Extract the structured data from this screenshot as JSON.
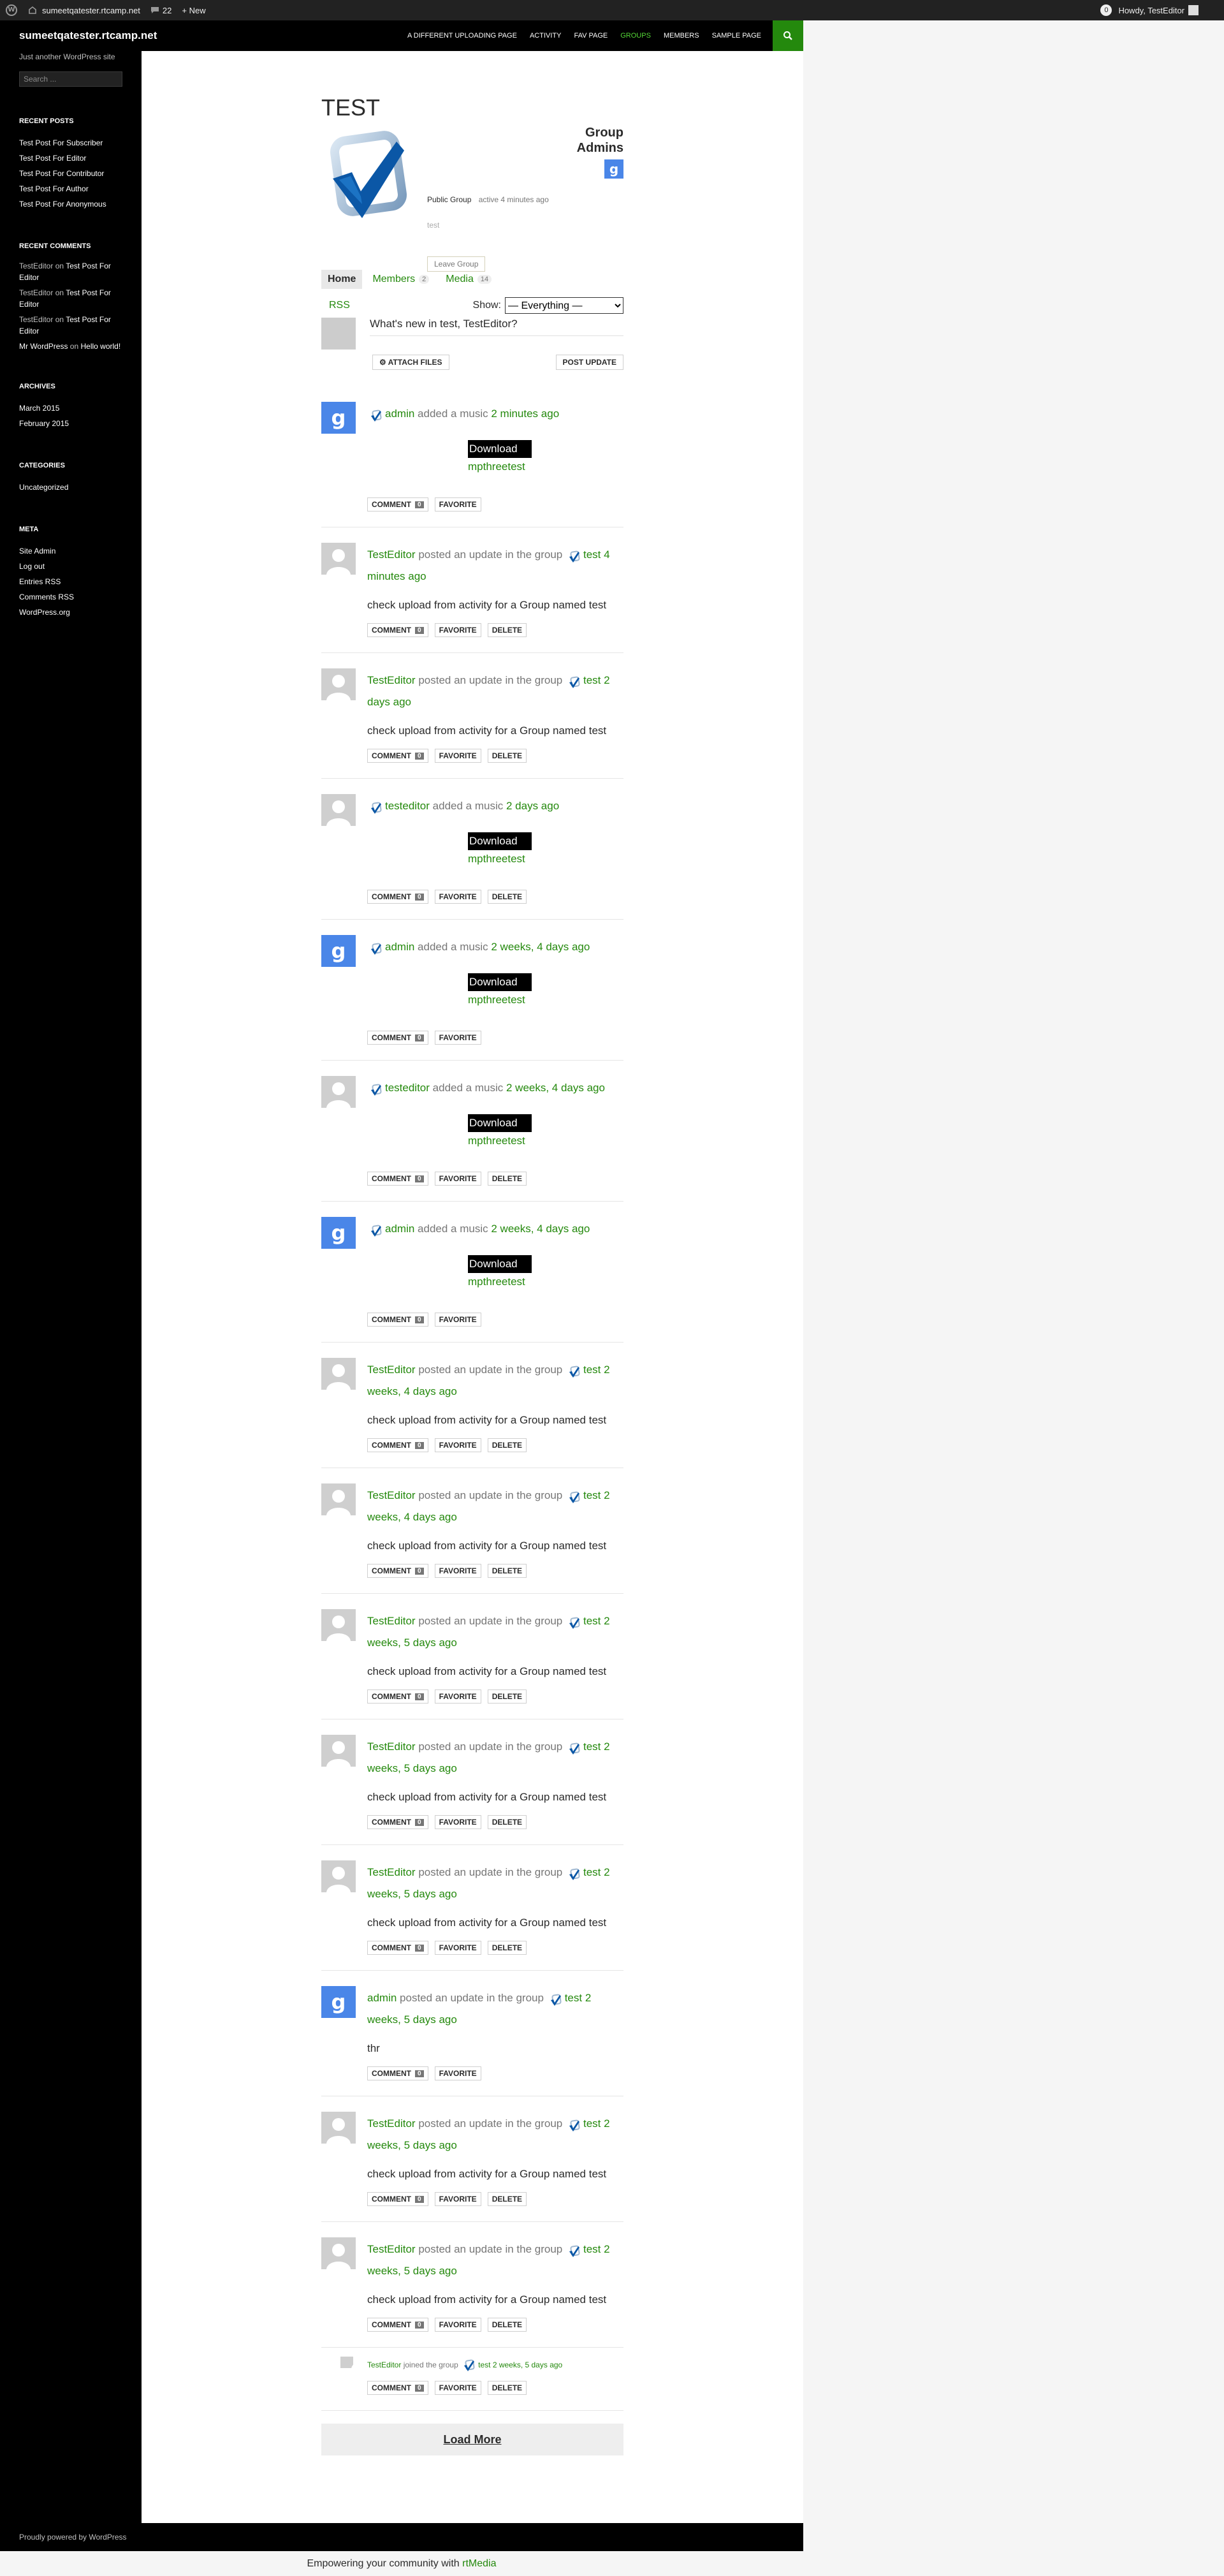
{
  "adminbar": {
    "site": "sumeetqatester.rtcamp.net",
    "comments_count": "22",
    "new_label": "+ New",
    "notifications": "0",
    "greeting": "Howdy, TestEditor"
  },
  "header": {
    "site_title": "sumeetqatester.rtcamp.net",
    "nav": [
      "A DIFFERENT UPLOADING PAGE",
      "ACTIVITY",
      "FAV PAGE",
      "GROUPS",
      "MEMBERS",
      "SAMPLE PAGE"
    ],
    "active_nav": "GROUPS"
  },
  "sidebar": {
    "description": "Just another WordPress site",
    "search_placeholder": "Search ...",
    "recent_posts_title": "RECENT POSTS",
    "recent_posts": [
      "Test Post For Subscriber",
      "Test Post For Editor",
      "Test Post For Contributor",
      "Test Post For Author",
      "Test Post For Anonymous"
    ],
    "recent_comments_title": "RECENT COMMENTS",
    "recent_comments": [
      {
        "author": "TestEditor",
        "on": "on",
        "post": "Test Post For Editor"
      },
      {
        "author": "TestEditor",
        "on": "on",
        "post": "Test Post For Editor"
      },
      {
        "author": "TestEditor",
        "on": "on",
        "post": "Test Post For Editor"
      },
      {
        "author": "Mr WordPress",
        "on": "on",
        "post": "Hello world!"
      }
    ],
    "archives_title": "ARCHIVES",
    "archives": [
      "March 2015",
      "February 2015"
    ],
    "categories_title": "CATEGORIES",
    "categories": [
      "Uncategorized"
    ],
    "meta_title": "META",
    "meta": [
      "Site Admin",
      "Log out",
      "Entries RSS",
      "Comments RSS",
      "WordPress.org"
    ]
  },
  "group": {
    "title": "TEST",
    "admins_title": "Group Admins",
    "type": "Public Group",
    "active": "active 4 minutes ago",
    "description": "test",
    "leave": "Leave Group"
  },
  "tabs": [
    {
      "label": "Home",
      "count": ""
    },
    {
      "label": "Members",
      "count": "2"
    },
    {
      "label": "Media",
      "count": "14"
    }
  ],
  "filter": {
    "rss": "RSS",
    "show_label": "Show:",
    "selected": "— Everything —"
  },
  "whats_new": {
    "prompt": "What's new in test, TestEditor?",
    "attach": "ATTACH FILES",
    "post": "POST UPDATE"
  },
  "activities": [
    {
      "type": "music",
      "avatar": "g",
      "user": "admin",
      "action": "added a music",
      "time": "2 minutes ago",
      "download": "Download",
      "file": "mpthreetest",
      "buttons": [
        "COMMENT",
        "FAVORITE"
      ],
      "count": "0"
    },
    {
      "type": "update",
      "avatar": "p",
      "user": "TestEditor",
      "action": "posted an update in the group",
      "group": "test",
      "time": "4 minutes ago",
      "text": "check upload from activity for a Group named test",
      "buttons": [
        "COMMENT",
        "FAVORITE",
        "DELETE"
      ],
      "count": "0"
    },
    {
      "type": "update",
      "avatar": "p",
      "user": "TestEditor",
      "action": "posted an update in the group",
      "group": "test",
      "time": "2 days ago",
      "text": "check upload from activity for a Group named test",
      "buttons": [
        "COMMENT",
        "FAVORITE",
        "DELETE"
      ],
      "count": "0"
    },
    {
      "type": "music",
      "avatar": "p",
      "user": "testeditor",
      "action": "added a music",
      "time": "2 days ago",
      "download": "Download",
      "file": "mpthreetest",
      "buttons": [
        "COMMENT",
        "FAVORITE",
        "DELETE"
      ],
      "count": "0"
    },
    {
      "type": "music",
      "avatar": "g",
      "user": "admin",
      "action": "added a music",
      "time": "2 weeks, 4 days ago",
      "download": "Download",
      "file": "mpthreetest",
      "buttons": [
        "COMMENT",
        "FAVORITE"
      ],
      "count": "0"
    },
    {
      "type": "music",
      "avatar": "p",
      "user": "testeditor",
      "action": "added a music",
      "time": "2 weeks, 4 days ago",
      "download": "Download",
      "file": "mpthreetest",
      "buttons": [
        "COMMENT",
        "FAVORITE",
        "DELETE"
      ],
      "count": "0"
    },
    {
      "type": "music",
      "avatar": "g",
      "user": "admin",
      "action": "added a music",
      "time": "2 weeks, 4 days ago",
      "download": "Download",
      "file": "mpthreetest",
      "buttons": [
        "COMMENT",
        "FAVORITE"
      ],
      "count": "0"
    },
    {
      "type": "update",
      "avatar": "p",
      "user": "TestEditor",
      "action": "posted an update in the group",
      "group": "test",
      "time": "2 weeks, 4 days ago",
      "text": "check upload from activity for a Group named test",
      "buttons": [
        "COMMENT",
        "FAVORITE",
        "DELETE"
      ],
      "count": "0"
    },
    {
      "type": "update",
      "avatar": "p",
      "user": "TestEditor",
      "action": "posted an update in the group",
      "group": "test",
      "time": "2 weeks, 4 days ago",
      "text": "check upload from activity for a Group named test",
      "buttons": [
        "COMMENT",
        "FAVORITE",
        "DELETE"
      ],
      "count": "0"
    },
    {
      "type": "update",
      "avatar": "p",
      "user": "TestEditor",
      "action": "posted an update in the group",
      "group": "test",
      "time": "2 weeks, 5 days ago",
      "text": "check upload from activity for a Group named test",
      "buttons": [
        "COMMENT",
        "FAVORITE",
        "DELETE"
      ],
      "count": "0"
    },
    {
      "type": "update",
      "avatar": "p",
      "user": "TestEditor",
      "action": "posted an update in the group",
      "group": "test",
      "time": "2 weeks, 5 days ago",
      "text": "check upload from activity for a Group named test",
      "buttons": [
        "COMMENT",
        "FAVORITE",
        "DELETE"
      ],
      "count": "0"
    },
    {
      "type": "update",
      "avatar": "p",
      "user": "TestEditor",
      "action": "posted an update in the group",
      "group": "test",
      "time": "2 weeks, 5 days ago",
      "text": "check upload from activity for a Group named test",
      "buttons": [
        "COMMENT",
        "FAVORITE",
        "DELETE"
      ],
      "count": "0"
    },
    {
      "type": "update",
      "avatar": "g",
      "user": "admin",
      "action": "posted an update in the group",
      "group": "test",
      "time": "2 weeks, 5 days ago",
      "text": "thr",
      "buttons": [
        "COMMENT",
        "FAVORITE"
      ],
      "count": "0"
    },
    {
      "type": "update",
      "avatar": "p",
      "user": "TestEditor",
      "action": "posted an update in the group",
      "group": "test",
      "time": "2 weeks, 5 days ago",
      "text": "check upload from activity for a Group named test",
      "buttons": [
        "COMMENT",
        "FAVORITE",
        "DELETE"
      ],
      "count": "0"
    },
    {
      "type": "update",
      "avatar": "p",
      "user": "TestEditor",
      "action": "posted an update in the group",
      "group": "test",
      "time": "2 weeks, 5 days ago",
      "text": "check upload from activity for a Group named test",
      "buttons": [
        "COMMENT",
        "FAVORITE",
        "DELETE"
      ],
      "count": "0"
    },
    {
      "type": "joined",
      "avatar": "p",
      "user": "TestEditor",
      "action": "joined the group",
      "group": "test",
      "time": "2 weeks, 5 days ago",
      "buttons": [
        "COMMENT",
        "FAVORITE",
        "DELETE"
      ],
      "count": "0"
    }
  ],
  "load_more": "Load More",
  "footer": {
    "powered": "Proudly powered by WordPress",
    "rt_text": "Empowering your community with",
    "rt_link": "rtMedia"
  },
  "colors": {
    "accent": "#24890d",
    "nav_active": "#55d737",
    "dark": "#000000"
  }
}
